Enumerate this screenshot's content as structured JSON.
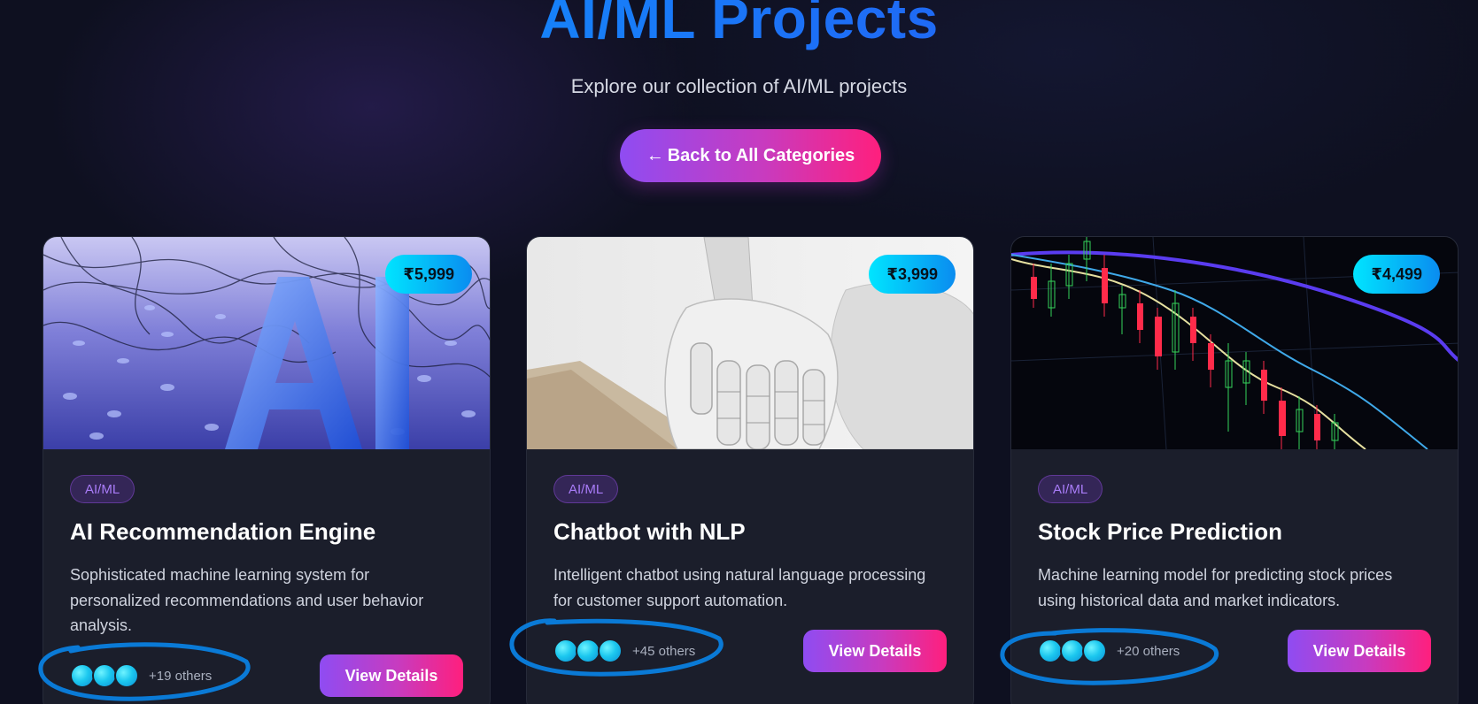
{
  "header": {
    "title": "AI/ML Projects",
    "subtitle": "Explore our collection of AI/ML projects",
    "back_button": {
      "arrow": "←",
      "label": "Back to All Categories"
    }
  },
  "cards": [
    {
      "image_icon": "ai-letters-image",
      "price": "₹5,999",
      "category": "AI/ML",
      "title": "AI Recommendation Engine",
      "description": "Sophisticated machine learning system for personalized recommendations and user behavior analysis.",
      "others": "+19 others",
      "button": "View Details"
    },
    {
      "image_icon": "robot-hand-image",
      "price": "₹3,999",
      "category": "AI/ML",
      "title": "Chatbot with NLP",
      "description": "Intelligent chatbot using natural language processing for customer support automation.",
      "others": "+45 others",
      "button": "View Details"
    },
    {
      "image_icon": "stock-candlestick-image",
      "price": "₹4,499",
      "category": "AI/ML",
      "title": "Stock Price Prediction",
      "description": "Machine learning model for predicting stock prices using historical data and market indicators.",
      "others": "+20 others",
      "button": "View Details"
    }
  ],
  "colors": {
    "accent_gradient_start": "#8f4cf2",
    "accent_gradient_end": "#ff1f7d",
    "price_gradient_start": "#00e5ff",
    "price_gradient_end": "#0a8cf0",
    "title_blue": "#1e6cf5",
    "annotation_blue": "#0a7ad6"
  }
}
